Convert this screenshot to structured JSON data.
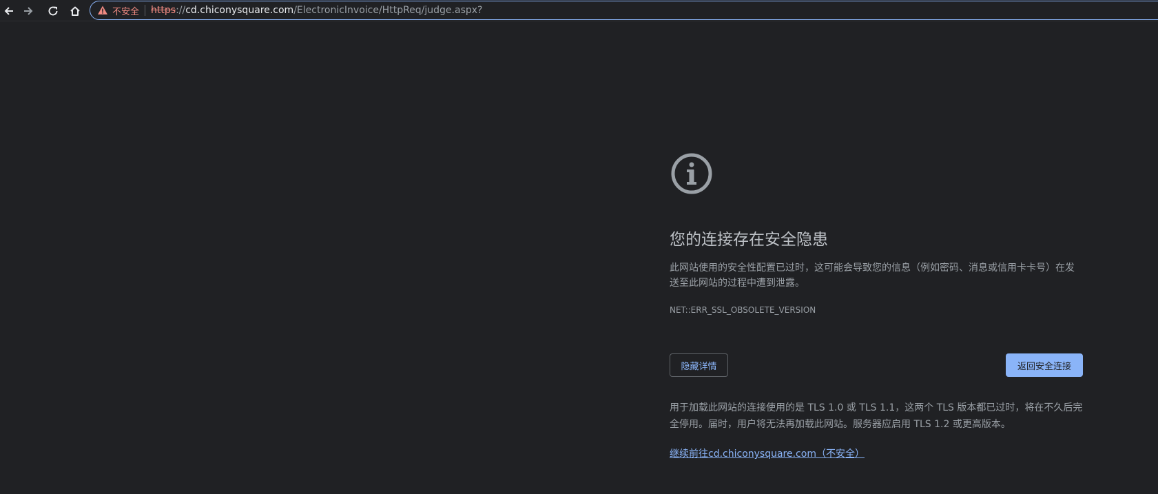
{
  "browser": {
    "security_label": "不安全",
    "url_scheme": "https",
    "url_scheme_rest": "://",
    "url_host": "cd.chiconysquare.com",
    "url_path": "/ElectronicInvoice/HttpReq/judge.aspx?"
  },
  "icons": {
    "back": "back-arrow-icon",
    "forward": "forward-arrow-icon",
    "reload": "reload-icon",
    "home": "home-icon",
    "warning": "warning-triangle-icon",
    "info": "info-circle-icon"
  },
  "interstitial": {
    "heading": "您的连接存在安全隐患",
    "description": "此网站使用的安全性配置已过时，这可能会导致您的信息（例如密码、消息或信用卡卡号）在发送至此网站的过程中遭到泄露。",
    "error_code": "NET::ERR_SSL_OBSOLETE_VERSION",
    "hide_details_label": "隐藏详情",
    "back_to_safety_label": "返回安全连接",
    "details_text": "用于加载此网站的连接使用的是 TLS 1.0 或 TLS 1.1，这两个 TLS 版本都已过时，将在不久后完全停用。届时，用户将无法再加载此网站。服务器应启用 TLS 1.2 或更高版本。",
    "proceed_link": "继续前往cd.chiconysquare.com（不安全）"
  },
  "colors": {
    "background": "#202124",
    "accent": "#8ab4f8",
    "danger": "#f28b82",
    "text": "#9aa0a6"
  }
}
